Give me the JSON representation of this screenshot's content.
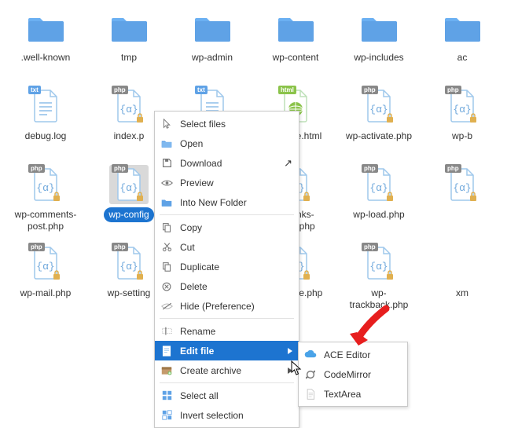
{
  "files": [
    {
      "name": ".well-known",
      "type": "folder"
    },
    {
      "name": "tmp",
      "type": "folder"
    },
    {
      "name": "wp-admin",
      "type": "folder"
    },
    {
      "name": "wp-content",
      "type": "folder"
    },
    {
      "name": "wp-includes",
      "type": "folder"
    },
    {
      "name": "ac",
      "type": "folder-partial"
    },
    {
      "name": "debug.log",
      "type": "txt"
    },
    {
      "name": "index.p",
      "type": "php"
    },
    {
      "name": "",
      "type": "txt-partial"
    },
    {
      "name": "readme.html",
      "type": "html"
    },
    {
      "name": "wp-activate.php",
      "type": "php"
    },
    {
      "name": "wp-b",
      "type": "php-partial"
    },
    {
      "name": "wp-comments-\npost.php",
      "type": "php"
    },
    {
      "name": "wp-config",
      "type": "php",
      "selected": true
    },
    {
      "name": "",
      "type": "blank"
    },
    {
      "name": "wp-links-opml.php",
      "type": "php"
    },
    {
      "name": "wp-load.php",
      "type": "php"
    },
    {
      "name": "",
      "type": "php-partial"
    },
    {
      "name": "wp-mail.php",
      "type": "php"
    },
    {
      "name": "wp-setting",
      "type": "php"
    },
    {
      "name": "",
      "type": "blank"
    },
    {
      "name": "wp-taste.php",
      "type": "php"
    },
    {
      "name": "wp-trackback.php",
      "type": "php"
    },
    {
      "name": "xm",
      "type": "partial"
    }
  ],
  "ctx": {
    "selectFiles": "Select files",
    "open": "Open",
    "download": "Download",
    "preview": "Preview",
    "intoNewFolder": "Into New Folder",
    "copy": "Copy",
    "cut": "Cut",
    "duplicate": "Duplicate",
    "delete": "Delete",
    "hide": "Hide (Preference)",
    "rename": "Rename",
    "editFile": "Edit file",
    "createArchive": "Create archive",
    "selectAll": "Select all",
    "invertSelection": "Invert selection"
  },
  "submenu": {
    "ace": "ACE Editor",
    "codemirror": "CodeMirror",
    "textarea": "TextArea"
  },
  "badges": {
    "txt": "txt",
    "php": "php",
    "html": "html"
  },
  "colors": {
    "accent": "#1d74d0",
    "folder": "#5fa2e6",
    "txtBadge": "#5fa2e6",
    "phpBadge": "#888",
    "htmlBadge": "#8bc34a"
  }
}
